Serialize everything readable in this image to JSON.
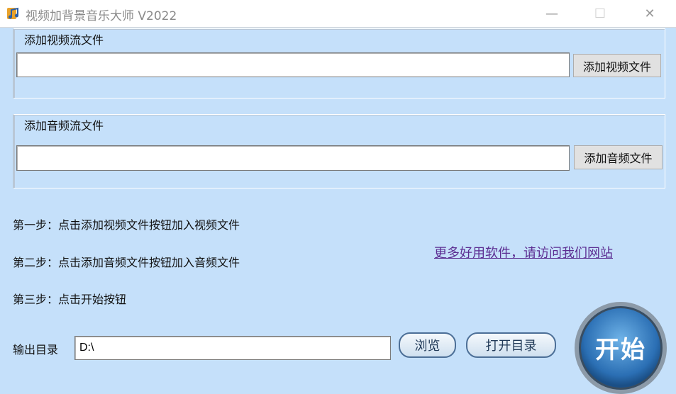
{
  "window": {
    "title": "视频加背景音乐大师 V2022",
    "controls": {
      "minimize": "—",
      "maximize": "☐",
      "close": "✕"
    }
  },
  "video_group": {
    "legend": "添加视频流文件",
    "path_value": "",
    "button_label": "添加视频文件"
  },
  "audio_group": {
    "legend": "添加音频流文件",
    "path_value": "",
    "button_label": "添加音频文件"
  },
  "steps": [
    "第一步：点击添加视频文件按钮加入视频文件",
    "第二步：点击添加音频文件按钮加入音频文件",
    "第三步：点击开始按钮"
  ],
  "promo_link": "更多好用软件，请访问我们网站",
  "output": {
    "label": "输出目录",
    "path_value": "D:\\",
    "browse_label": "浏览",
    "open_dir_label": "打开目录"
  },
  "start_button_label": "开始",
  "colors": {
    "background": "#c5e0fa",
    "link": "#5b2c91",
    "start_button": "#2b6fb4"
  },
  "icons": {
    "app": "music-note-icon"
  }
}
